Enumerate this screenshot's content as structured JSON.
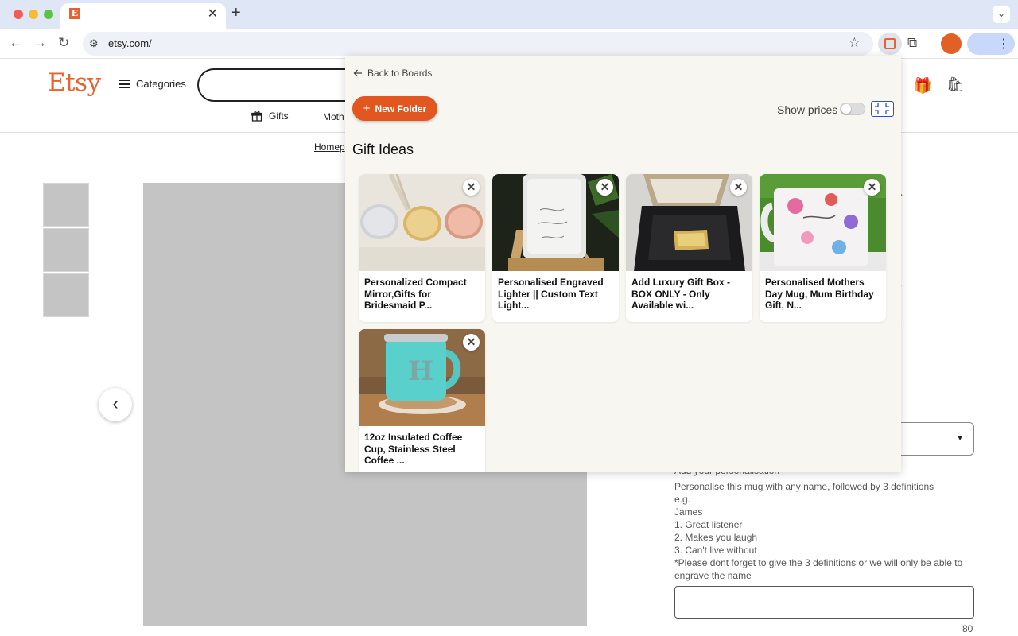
{
  "browser": {
    "tab_favicon_letter": "E",
    "tab_close": "✕",
    "new_tab": "+",
    "tab_menu": "⌄",
    "back": "←",
    "forward": "→",
    "reload": "↻",
    "site_settings_icon": "⚙",
    "url": "etsy.com/",
    "bookmark_star": "☆",
    "puzzle": "⧉",
    "menu_dots": "⋮"
  },
  "etsy": {
    "logo": "Etsy",
    "categories_label": "Categories",
    "gift_icon": "🎁",
    "basket_icon": "🛍",
    "subnav_gifts": "Gifts",
    "subnav_mothers": "Moth",
    "breadcrumb": "Homep",
    "prev_arrow": "‹",
    "select_arrow": "▼",
    "personalise_heading": "Add your personalisation",
    "instructions": [
      "Personalise this mug with any name, followed by 3 definitions",
      "e.g.",
      "James",
      "1. Great listener",
      "2. Makes you laugh",
      "3. Can't live without",
      "*Please dont forget to give the 3 definitions or we will only be able to engrave the name"
    ],
    "char_count": "80"
  },
  "panel": {
    "back_label": "Back to Boards",
    "new_folder_label": "New Folder",
    "show_prices_label": "Show prices",
    "show_prices_on": false,
    "board_title": "Gift Ideas",
    "close_glyph": "✕",
    "items": [
      {
        "title": "Personalized Compact Mirror,Gifts for Bridesmaid P..."
      },
      {
        "title": "Personalised Engraved Lighter || Custom Text Light..."
      },
      {
        "title": "Add Luxury Gift Box - BOX ONLY - Only Available wi..."
      },
      {
        "title": "Personalised Mothers Day Mug, Mum Birthday Gift, N..."
      },
      {
        "title": "12oz Insulated Coffee Cup, Stainless Steel Coffee ..."
      }
    ]
  },
  "colors": {
    "etsy_orange": "#e7622d",
    "new_folder_bg": "#e2571f",
    "panel_bg": "#f8f6f1",
    "collapse_border": "#2c4dd4"
  }
}
